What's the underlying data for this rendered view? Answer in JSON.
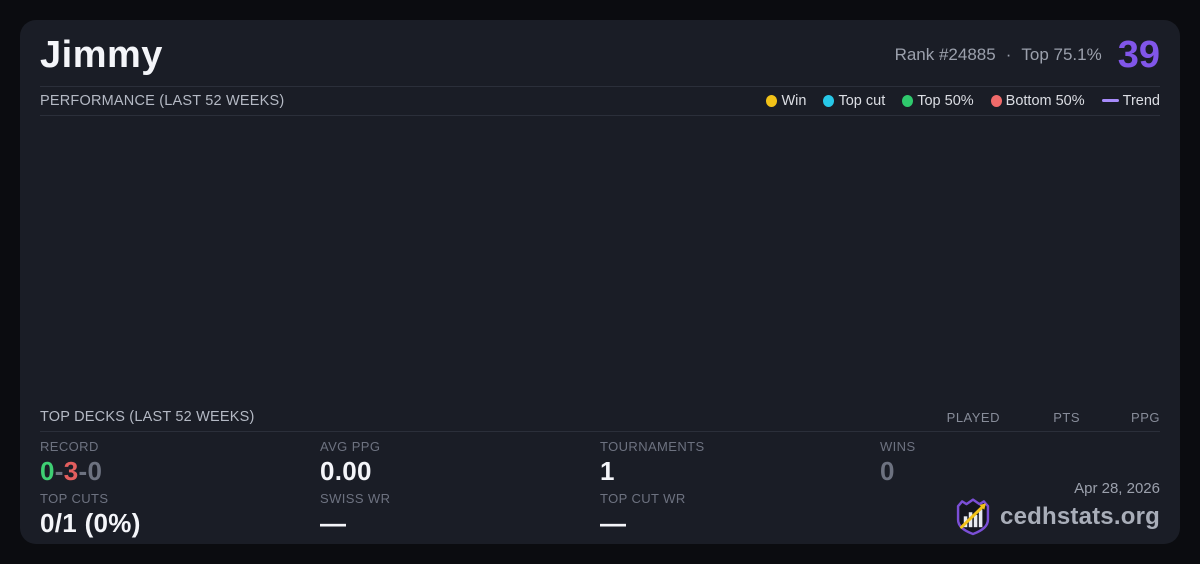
{
  "header": {
    "player_name": "Jimmy",
    "rank_label": "Rank #24885",
    "separator": "·",
    "percentile_label": "Top 75.1%",
    "score": "39"
  },
  "performance": {
    "title": "PERFORMANCE (LAST 52 WEEKS)",
    "legend": {
      "win": "Win",
      "top_cut": "Top cut",
      "top50": "Top 50%",
      "bottom50": "Bottom 50%",
      "trend": "Trend"
    }
  },
  "top_decks": {
    "title": "TOP DECKS (LAST 52 WEEKS)",
    "columns": [
      "PLAYED",
      "PTS",
      "PPG"
    ],
    "rows": []
  },
  "stats": {
    "record": {
      "label": "RECORD",
      "wins": "0",
      "sep1": "-",
      "losses": "3",
      "sep2": "-",
      "draws": "0"
    },
    "avg_ppg": {
      "label": "AVG PPG",
      "value": "0.00"
    },
    "tournaments": {
      "label": "TOURNAMENTS",
      "value": "1"
    },
    "wins": {
      "label": "WINS",
      "value": "0"
    },
    "top_cuts": {
      "label": "TOP CUTS",
      "value": "0/1 (0%)"
    },
    "swiss_wr": {
      "label": "SWISS WR",
      "value": "—"
    },
    "top_cut_wr": {
      "label": "TOP CUT WR",
      "value": "—"
    }
  },
  "footer": {
    "date": "Apr 28, 2026",
    "brand": "cedhstats.org"
  },
  "colors": {
    "accent_purple": "#8156e9",
    "win_yellow": "#f2c218",
    "top_cut_cyan": "#27c8e8",
    "top_50_green": "#2fc96d",
    "bottom_50_red": "#f06a6a",
    "trend_purple": "#a78bfa",
    "record_win_green": "#3ecf73",
    "record_loss_red": "#e25e5e",
    "card_background": "#1a1d26",
    "page_background": "#0b0c10"
  }
}
